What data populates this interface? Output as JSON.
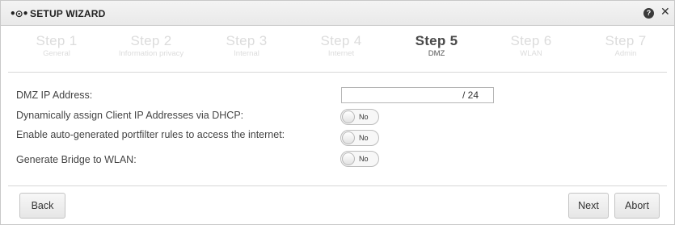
{
  "window": {
    "title": "SETUP WIZARD",
    "logo_glyph": "•⊙•",
    "help_glyph": "?",
    "close_glyph": "✕"
  },
  "steps": [
    {
      "label": "Step 1",
      "sub": "General",
      "active": false
    },
    {
      "label": "Step 2",
      "sub": "Information privacy",
      "active": false
    },
    {
      "label": "Step 3",
      "sub": "Internal",
      "active": false
    },
    {
      "label": "Step 4",
      "sub": "Internet",
      "active": false
    },
    {
      "label": "Step 5",
      "sub": "DMZ",
      "active": true
    },
    {
      "label": "Step 6",
      "sub": "WLAN",
      "active": false
    },
    {
      "label": "Step 7",
      "sub": "Admin",
      "active": false
    }
  ],
  "form": {
    "dmz_ip": {
      "label": "DMZ IP Address:",
      "value": "",
      "suffix": "/ 24"
    },
    "dhcp": {
      "label": "Dynamically assign Client IP Addresses via DHCP:",
      "state": "No"
    },
    "portfilter": {
      "label": "Enable auto-generated portfilter rules to access the internet:",
      "state": "No"
    },
    "bridge": {
      "label": "Generate Bridge to WLAN:",
      "state": "No"
    }
  },
  "buttons": {
    "back": "Back",
    "next": "Next",
    "abort": "Abort"
  },
  "icons": {
    "logo": "logo-icon",
    "help": "help-icon",
    "close": "close-icon"
  }
}
